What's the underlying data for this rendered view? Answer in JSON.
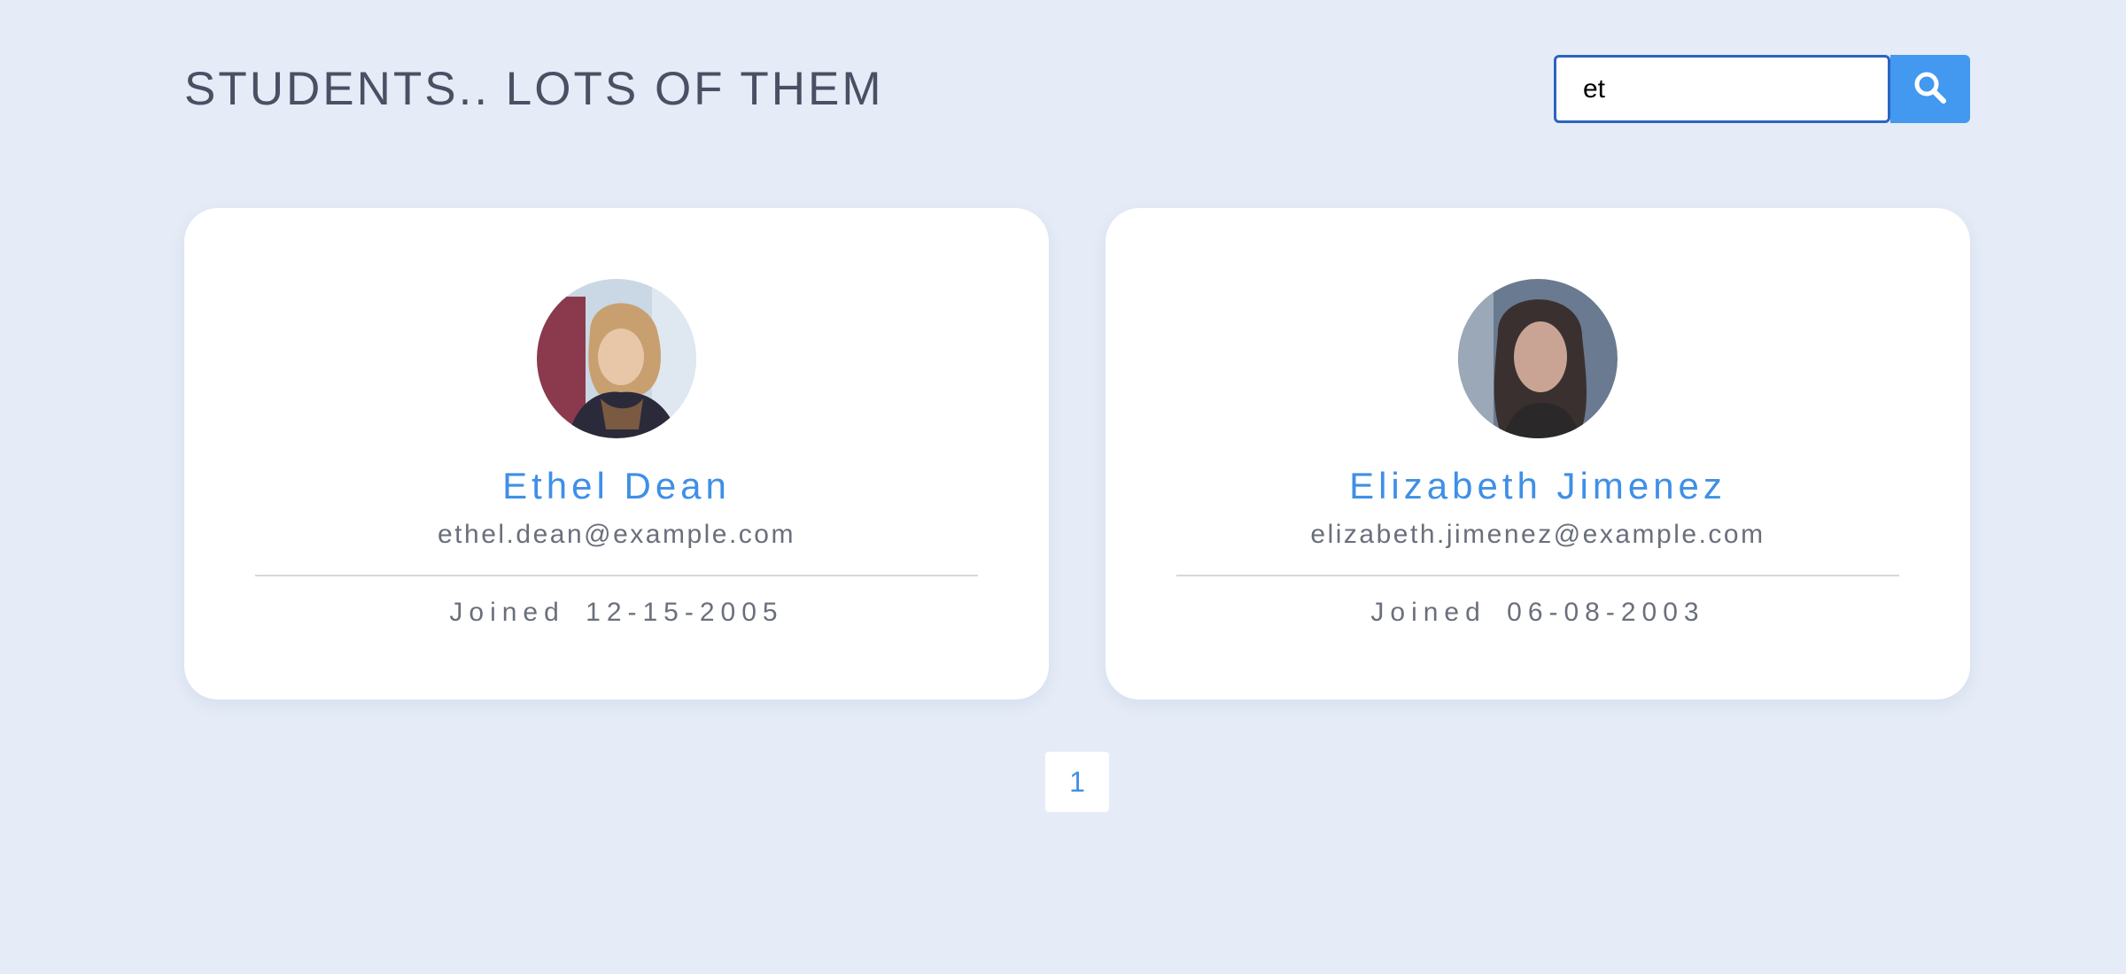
{
  "header": {
    "title": "STUDENTS.. LOTS OF THEM"
  },
  "search": {
    "value": "et",
    "placeholder": "",
    "button_icon": "search-icon"
  },
  "students": [
    {
      "name": "Ethel Dean",
      "email": "ethel.dean@example.com",
      "joined_label": "Joined",
      "joined_date": "12-15-2005"
    },
    {
      "name": "Elizabeth Jimenez",
      "email": "elizabeth.jimenez@example.com",
      "joined_label": "Joined",
      "joined_date": "06-08-2003"
    }
  ],
  "pagination": {
    "pages": [
      "1"
    ],
    "current": "1"
  },
  "colors": {
    "background": "#e5ecf7",
    "accent": "#4398f0",
    "name_text": "#3f8fe6",
    "title_text": "#4a5064",
    "muted_text": "#6a6f7c"
  }
}
